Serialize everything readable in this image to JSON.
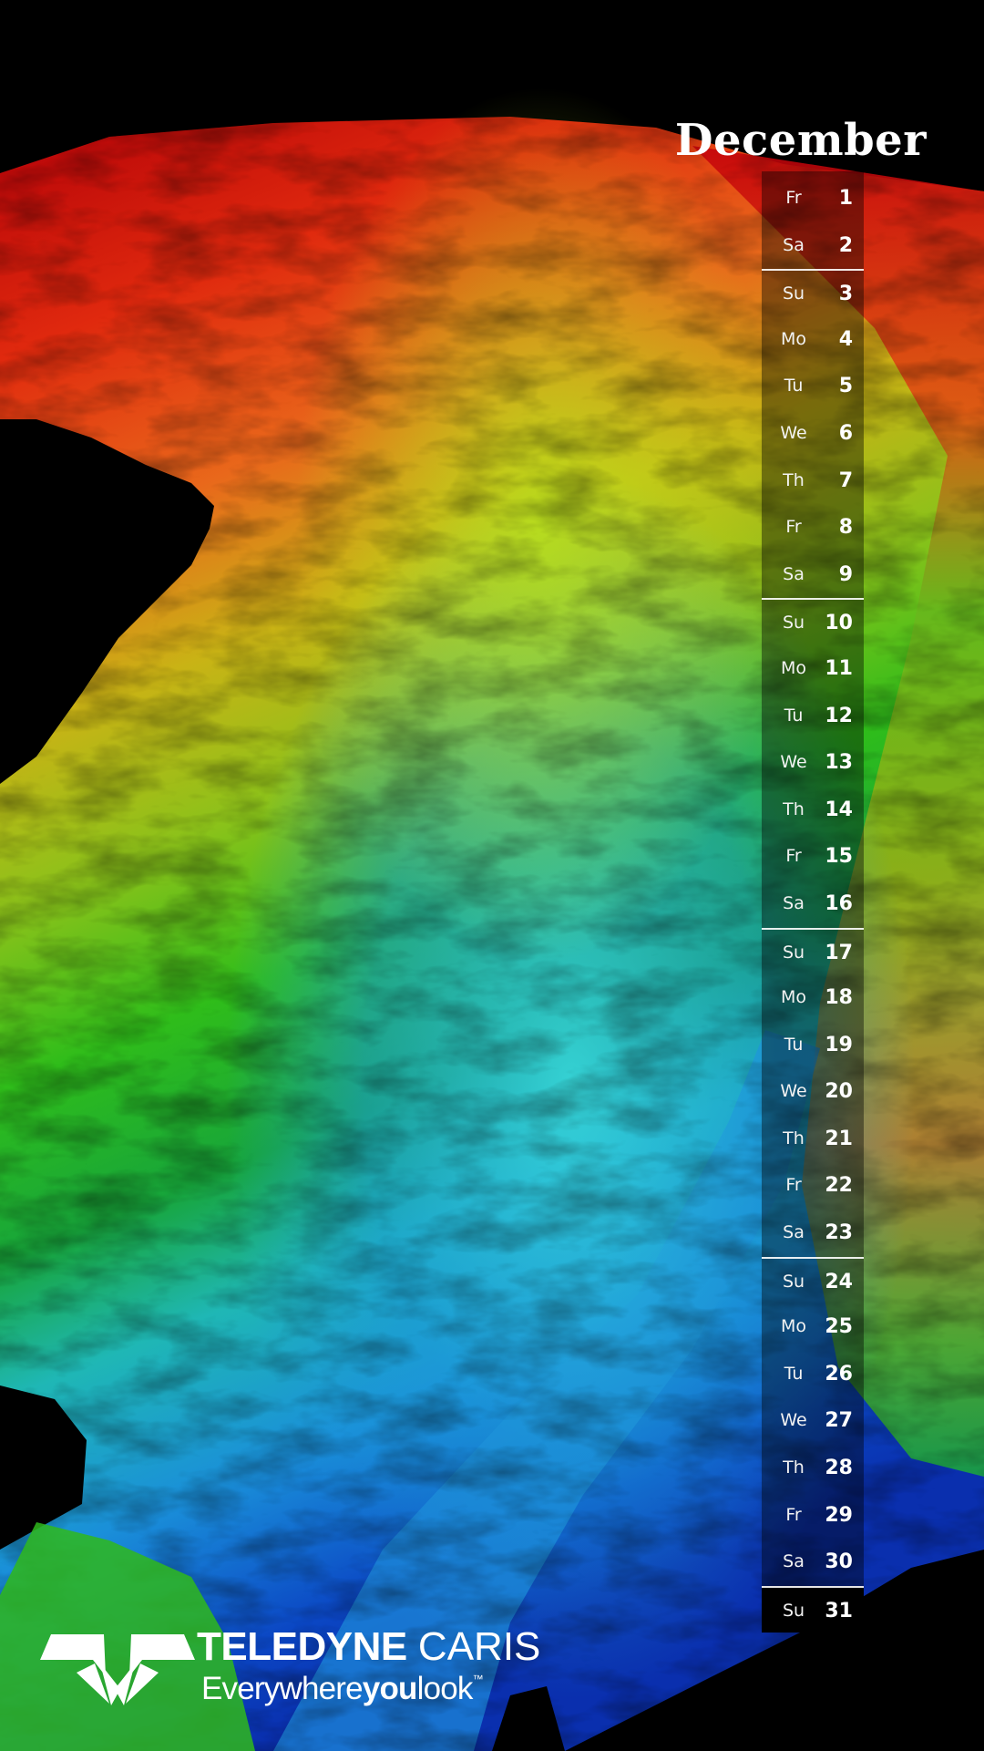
{
  "calendar": {
    "month": "December",
    "days": [
      {
        "wd": "Fr",
        "d": "1"
      },
      {
        "wd": "Sa",
        "d": "2"
      },
      {
        "wd": "Su",
        "d": "3"
      },
      {
        "wd": "Mo",
        "d": "4"
      },
      {
        "wd": "Tu",
        "d": "5"
      },
      {
        "wd": "We",
        "d": "6"
      },
      {
        "wd": "Th",
        "d": "7"
      },
      {
        "wd": "Fr",
        "d": "8"
      },
      {
        "wd": "Sa",
        "d": "9"
      },
      {
        "wd": "Su",
        "d": "10"
      },
      {
        "wd": "Mo",
        "d": "11"
      },
      {
        "wd": "Tu",
        "d": "12"
      },
      {
        "wd": "We",
        "d": "13"
      },
      {
        "wd": "Th",
        "d": "14"
      },
      {
        "wd": "Fr",
        "d": "15"
      },
      {
        "wd": "Sa",
        "d": "16"
      },
      {
        "wd": "Su",
        "d": "17"
      },
      {
        "wd": "Mo",
        "d": "18"
      },
      {
        "wd": "Tu",
        "d": "19"
      },
      {
        "wd": "We",
        "d": "20"
      },
      {
        "wd": "Th",
        "d": "21"
      },
      {
        "wd": "Fr",
        "d": "22"
      },
      {
        "wd": "Sa",
        "d": "23"
      },
      {
        "wd": "Su",
        "d": "24"
      },
      {
        "wd": "Mo",
        "d": "25"
      },
      {
        "wd": "Tu",
        "d": "26"
      },
      {
        "wd": "We",
        "d": "27"
      },
      {
        "wd": "Th",
        "d": "28"
      },
      {
        "wd": "Fr",
        "d": "29"
      },
      {
        "wd": "Sa",
        "d": "30"
      },
      {
        "wd": "Su",
        "d": "31"
      }
    ]
  },
  "brand": {
    "name_bold": "TELEDYNE",
    "name_light": " CARIS",
    "tagline_a": "Everywhere",
    "tagline_b": "you",
    "tagline_c": "look",
    "tagline_tm": "™"
  },
  "colors": {
    "background": "#000000",
    "terrain_high": "#d40f0a",
    "terrain_mid": "#7ac31a",
    "terrain_low": "#0a63d8",
    "text": "#ffffff"
  },
  "icons": [
    "teledyne-logo-icon"
  ]
}
